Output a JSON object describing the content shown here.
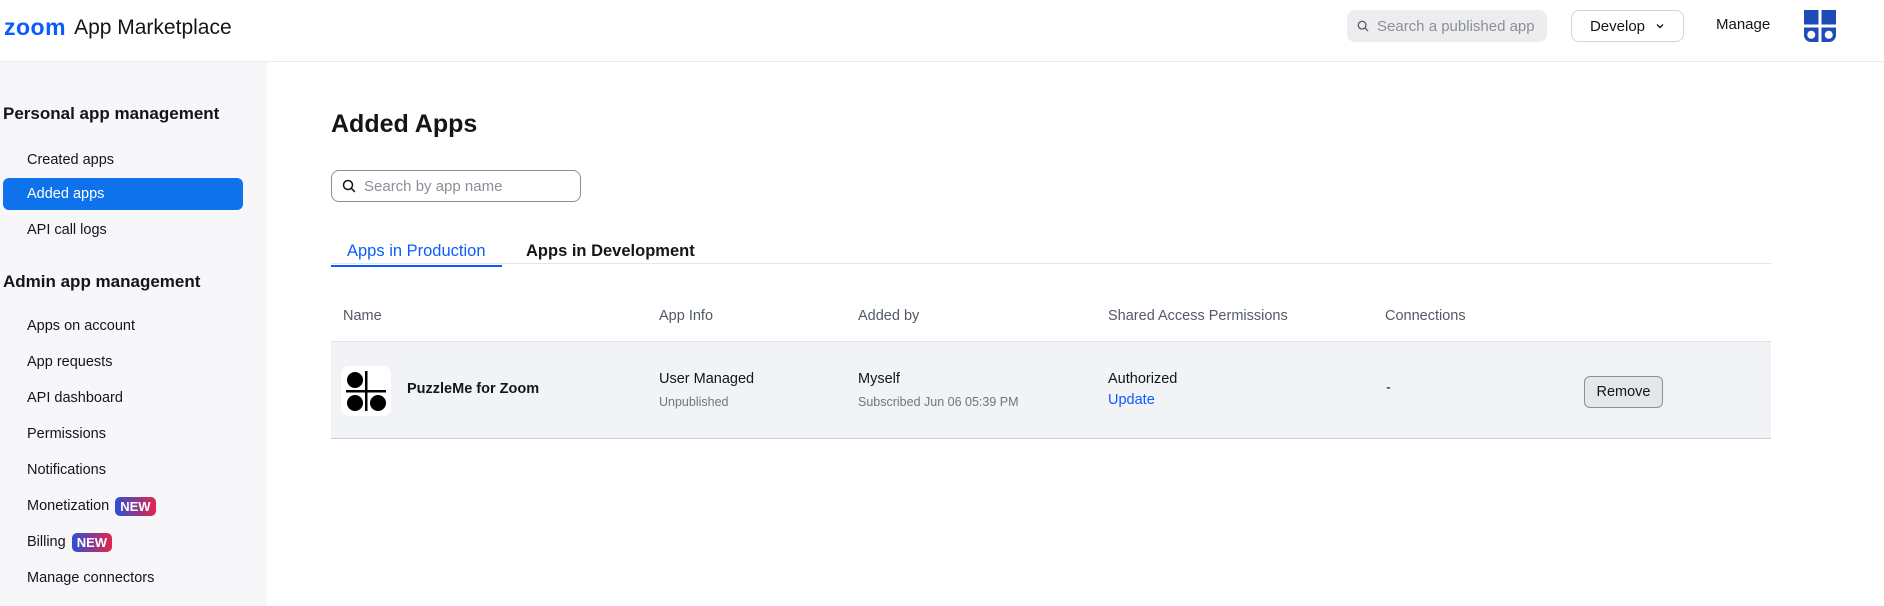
{
  "header": {
    "logo_brand": "zoom",
    "logo_text": "App Marketplace",
    "search_placeholder": "Search a published app",
    "develop_label": "Develop",
    "manage_label": "Manage"
  },
  "sidebar": {
    "personal_title": "Personal app management",
    "personal_items": [
      {
        "label": "Created apps",
        "active": false
      },
      {
        "label": "Added apps",
        "active": true
      },
      {
        "label": "API call logs",
        "active": false
      }
    ],
    "admin_title": "Admin app management",
    "admin_items": [
      {
        "label": "Apps on account"
      },
      {
        "label": "App requests"
      },
      {
        "label": "API dashboard"
      },
      {
        "label": "Permissions"
      },
      {
        "label": "Notifications"
      },
      {
        "label": "Monetization",
        "badge": "NEW"
      },
      {
        "label": "Billing",
        "badge": "NEW"
      },
      {
        "label": "Manage connectors"
      }
    ]
  },
  "main": {
    "title": "Added Apps",
    "search_placeholder": "Search by app name",
    "tabs": [
      {
        "label": "Apps in Production",
        "active": true
      },
      {
        "label": "Apps in Development",
        "active": false
      }
    ],
    "table": {
      "columns": [
        "Name",
        "App Info",
        "Added by",
        "Shared Access Permissions",
        "Connections"
      ],
      "rows": [
        {
          "name": "PuzzleMe for Zoom",
          "app_info": "User Managed",
          "app_info_sub": "Unpublished",
          "added_by": "Myself",
          "added_by_sub": "Subscribed Jun 06 05:39 PM",
          "permission": "Authorized",
          "permission_link": "Update",
          "connections": "-",
          "action": "Remove"
        }
      ]
    }
  },
  "colors": {
    "brand": "#0b5cff",
    "active_nav": "#0e72ed"
  }
}
